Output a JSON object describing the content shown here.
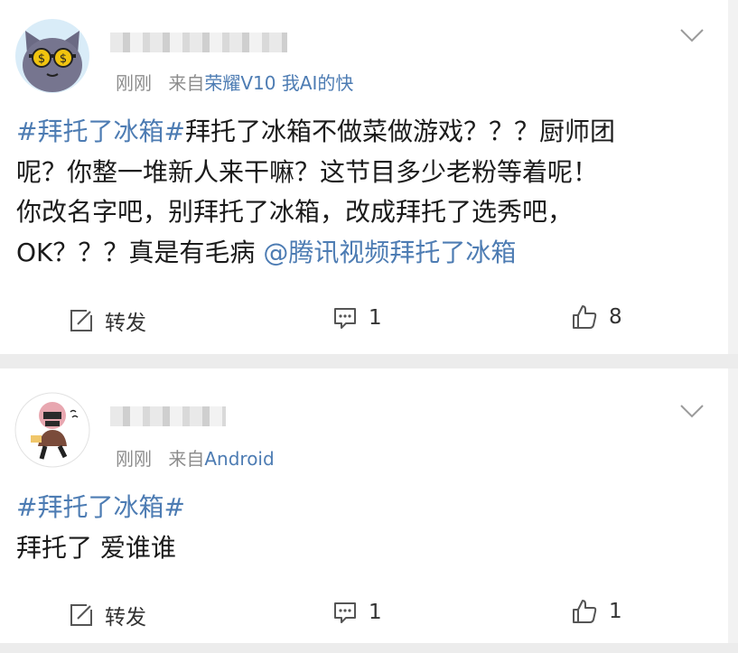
{
  "posts": [
    {
      "time": "刚刚",
      "from_label": "来自",
      "source": "荣耀V10 我AI的快",
      "content": {
        "hashtag": "#拜托了冰箱#",
        "line1_rest": "拜托了冰箱不做菜做游戏？？？厨师团",
        "line2": "呢？你整一堆新人来干嘛？这节目多少老粉等着呢！",
        "line3": "你改名字吧，别拜托了冰箱，改成拜托了选秀吧，",
        "line4_text": "OK？？？真是有毛病 ",
        "mention": "@腾讯视频拜托了冰箱"
      },
      "actions": {
        "repost_label": "转发",
        "comment_count": "1",
        "like_count": "8"
      }
    },
    {
      "time": "刚刚",
      "from_label": "来自",
      "source": "Android",
      "content": {
        "hashtag": "#拜托了冰箱#",
        "line2": "拜托了 爱谁谁"
      },
      "actions": {
        "repost_label": "转发",
        "comment_count": "1",
        "like_count": "1"
      }
    }
  ],
  "icons": [
    "cat-with-glasses-avatar",
    "character-avatar",
    "chevron-down-icon",
    "edit-repost-icon",
    "comment-icon",
    "thumbs-up-icon"
  ],
  "colors": {
    "link": "#4d7cb3",
    "meta": "#8c8c8c",
    "text": "#1b1b1b",
    "separator": "#ececec"
  }
}
